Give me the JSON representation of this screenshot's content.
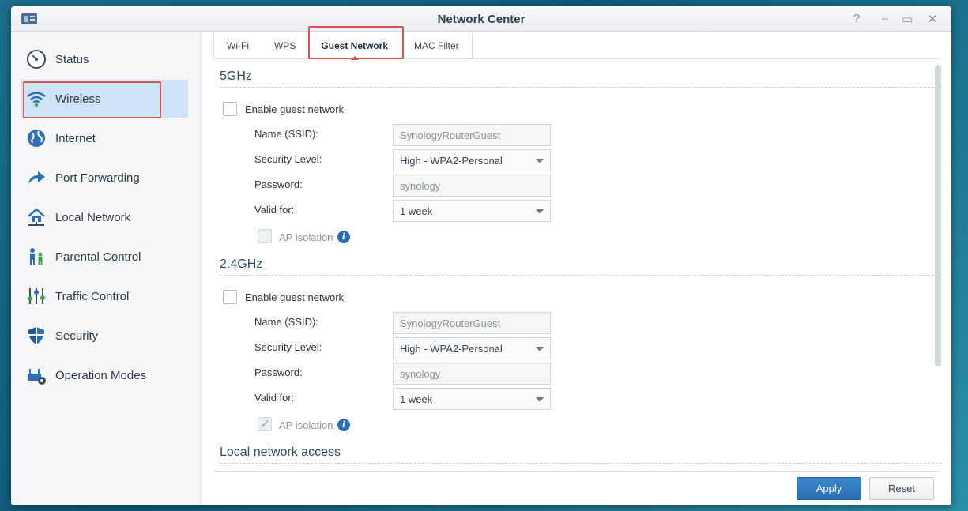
{
  "window": {
    "title": "Network Center"
  },
  "window_controls": {
    "help": "?",
    "minimize": "–",
    "maximize": "▭",
    "close": "✕"
  },
  "sidebar": {
    "items": [
      {
        "label": "Status",
        "icon": "gauge-icon"
      },
      {
        "label": "Wireless",
        "icon": "wifi-icon",
        "active": true
      },
      {
        "label": "Internet",
        "icon": "globe-icon"
      },
      {
        "label": "Port Forwarding",
        "icon": "arrow-forward-icon"
      },
      {
        "label": "Local Network",
        "icon": "house-network-icon"
      },
      {
        "label": "Parental Control",
        "icon": "family-icon"
      },
      {
        "label": "Traffic Control",
        "icon": "sliders-icon"
      },
      {
        "label": "Security",
        "icon": "shield-icon"
      },
      {
        "label": "Operation Modes",
        "icon": "router-gear-icon"
      }
    ]
  },
  "tabs": [
    {
      "label": "Wi-Fi"
    },
    {
      "label": "WPS"
    },
    {
      "label": "Guest Network",
      "active": true
    },
    {
      "label": "MAC Filter"
    }
  ],
  "sections": {
    "ghz5": {
      "title": "5GHz",
      "enable_label": "Enable guest network",
      "enabled": false,
      "ssid_label": "Name (SSID):",
      "ssid_value": "SynologyRouterGuest",
      "security_label": "Security Level:",
      "security_value": "High - WPA2-Personal",
      "password_label": "Password:",
      "password_value": "synology",
      "valid_label": "Valid for:",
      "valid_value": "1 week",
      "ap_isolation_label": "AP isolation",
      "ap_isolation_checked": false
    },
    "ghz24": {
      "title": "2.4GHz",
      "enable_label": "Enable guest network",
      "enabled": false,
      "ssid_label": "Name (SSID):",
      "ssid_value": "SynologyRouterGuest",
      "security_label": "Security Level:",
      "security_value": "High - WPA2-Personal",
      "password_label": "Password:",
      "password_value": "synology",
      "valid_label": "Valid for:",
      "valid_value": "1 week",
      "ap_isolation_label": "AP isolation",
      "ap_isolation_checked": true
    },
    "local_access": {
      "title": "Local network access"
    }
  },
  "info_glyph": "i",
  "check_glyph": "✓",
  "buttons": {
    "apply": "Apply",
    "reset": "Reset"
  },
  "colors": {
    "accent": "#2b6fb5",
    "highlight": "#d9534f",
    "active_nav": "#cfe3f7"
  }
}
